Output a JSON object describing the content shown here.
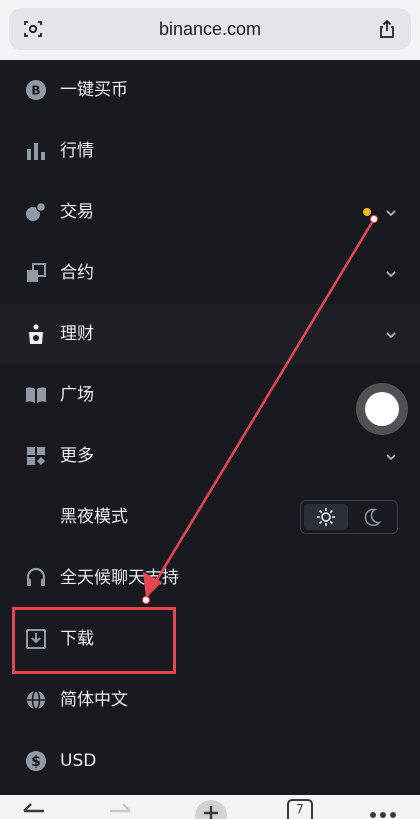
{
  "browser": {
    "url": "binance.com",
    "tab_count": "7",
    "icons": {
      "left": "reader-icon",
      "right": "share-icon"
    }
  },
  "menu": {
    "items": [
      {
        "label": "一键买币",
        "icon": "bitcoin-coin-icon"
      },
      {
        "label": "行情",
        "icon": "bar-chart-icon"
      },
      {
        "label": "交易",
        "icon": "trade-coins-icon",
        "has_chevron": true,
        "has_dot": true
      },
      {
        "label": "合约",
        "icon": "futures-icon",
        "has_chevron": true
      },
      {
        "label": "理财",
        "icon": "earn-icon",
        "has_chevron": true,
        "active": true
      },
      {
        "label": "广场",
        "icon": "book-icon"
      },
      {
        "label": "更多",
        "icon": "grid-more-icon",
        "has_chevron": true
      },
      {
        "label": "黑夜模式",
        "toggle": {
          "selected": "light"
        }
      },
      {
        "label": "全天候聊天支持",
        "icon": "headset-icon"
      },
      {
        "label": "下载",
        "icon": "download-icon"
      },
      {
        "label": "简体中文",
        "icon": "globe-icon"
      },
      {
        "label": "USD",
        "icon": "dollar-icon"
      }
    ]
  },
  "colors": {
    "background": "#181a20",
    "active_row": "#1e2026",
    "accent_dot": "#f0c01a",
    "annotation_red": "#e5464f"
  }
}
